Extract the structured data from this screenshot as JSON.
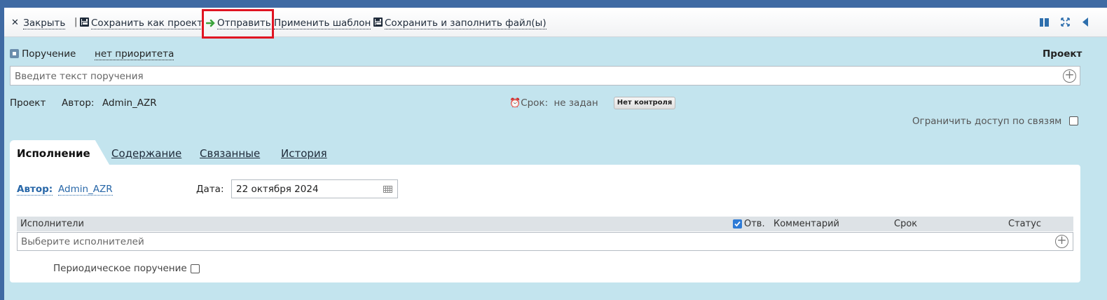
{
  "toolbar": {
    "close_label": "Закрыть",
    "separator": "|",
    "save_project_label": "Сохранить как проект",
    "send_label": "Отправить",
    "apply_template_label": "Применить шаблон",
    "save_fill_label": "Сохранить и заполнить файл(ы)"
  },
  "task": {
    "type_label": "Поручение",
    "priority_label": "нет приоритета",
    "status_label": "Проект",
    "text_placeholder": "Введите текст поручения",
    "project_label": "Проект",
    "author_caption": "Автор:",
    "author_name": "Admin_AZR",
    "deadline_label": "Срок:",
    "deadline_value": "не задан",
    "control_button": "Нет контроля",
    "restrict_label": "Ограничить доступ по связям"
  },
  "tabs": [
    {
      "label": "Исполнение",
      "active": true
    },
    {
      "label": "Содержание",
      "active": false
    },
    {
      "label": "Связанные",
      "active": false
    },
    {
      "label": "История",
      "active": false
    }
  ],
  "execution": {
    "author_caption": "Автор:",
    "author_name": "Admin_AZR",
    "date_caption": "Дата:",
    "date_value": "22 октября 2024",
    "columns": {
      "executors": "Исполнители",
      "resp": "Отв.",
      "comment": "Комментарий",
      "deadline": "Срок",
      "status": "Статус"
    },
    "executor_placeholder": "Выберите исполнителей",
    "periodic_label": "Периодическое поручение"
  },
  "colors": {
    "background": "#c3e4ee",
    "frame": "#3f6aa3",
    "highlight": "#e01422",
    "link": "#2867a8",
    "send_arrow": "#3aa33a"
  }
}
